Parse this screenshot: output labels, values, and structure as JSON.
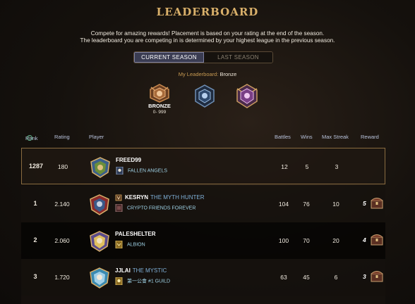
{
  "page": {
    "title": "LEADERBOARD",
    "desc_line1": "Compete for amazing rewards! Placement is based on your rating at the end of the season.",
    "desc_line2": "The leaderboard you are competing in is determined by your highest league in the previous season."
  },
  "seasons": {
    "current": "CURRENT SEASON",
    "last": "LAST SEASON",
    "selected": "CURRENT SEASON"
  },
  "my_league": {
    "label": "My Leaderboard:",
    "value": "Bronze"
  },
  "leagues": {
    "bronze": {
      "name": "BRONZE",
      "range": "0- 999",
      "icon": "bronze-league-icon"
    },
    "silver": {
      "icon": "silver-league-icon"
    },
    "gold": {
      "icon": "gold-league-icon"
    }
  },
  "columns": {
    "rank": "Rank",
    "rating": "Rating",
    "player": "Player",
    "battles": "Battles",
    "wins": "Wins",
    "max_streak": "Max Streak",
    "reward": "Reward"
  },
  "rows": {
    "me": {
      "rank": "1287",
      "rating": "180",
      "name": "FREED99",
      "title": "",
      "guild": "FALLEN ANGELS",
      "battles": "12",
      "wins": "5",
      "streak": "3",
      "reward": ""
    },
    "r1": {
      "rank": "1",
      "rating": "2.140",
      "name": "KESRYN",
      "title": "THE MYTH HUNTER",
      "guild": "CRYPTO FRIENDS FOREVER",
      "battles": "104",
      "wins": "76",
      "streak": "10",
      "reward": "5"
    },
    "r2": {
      "rank": "2",
      "rating": "2.060",
      "name": "PALESHELTER",
      "title": "",
      "guild": "ALBION",
      "battles": "100",
      "wins": "70",
      "streak": "20",
      "reward": "4"
    },
    "r3": {
      "rank": "3",
      "rating": "1.720",
      "name": "JJLAI",
      "title": "THE MYSTIC",
      "guild": "第一公會 #1 GUILD",
      "battles": "63",
      "wins": "45",
      "streak": "6",
      "reward": "3"
    }
  },
  "colors": {
    "accent_gold": "#d9b06a",
    "tab_active_bg": "#3a3c52",
    "guild_text": "#9fd2e6",
    "title_text": "#7fb0d8"
  }
}
